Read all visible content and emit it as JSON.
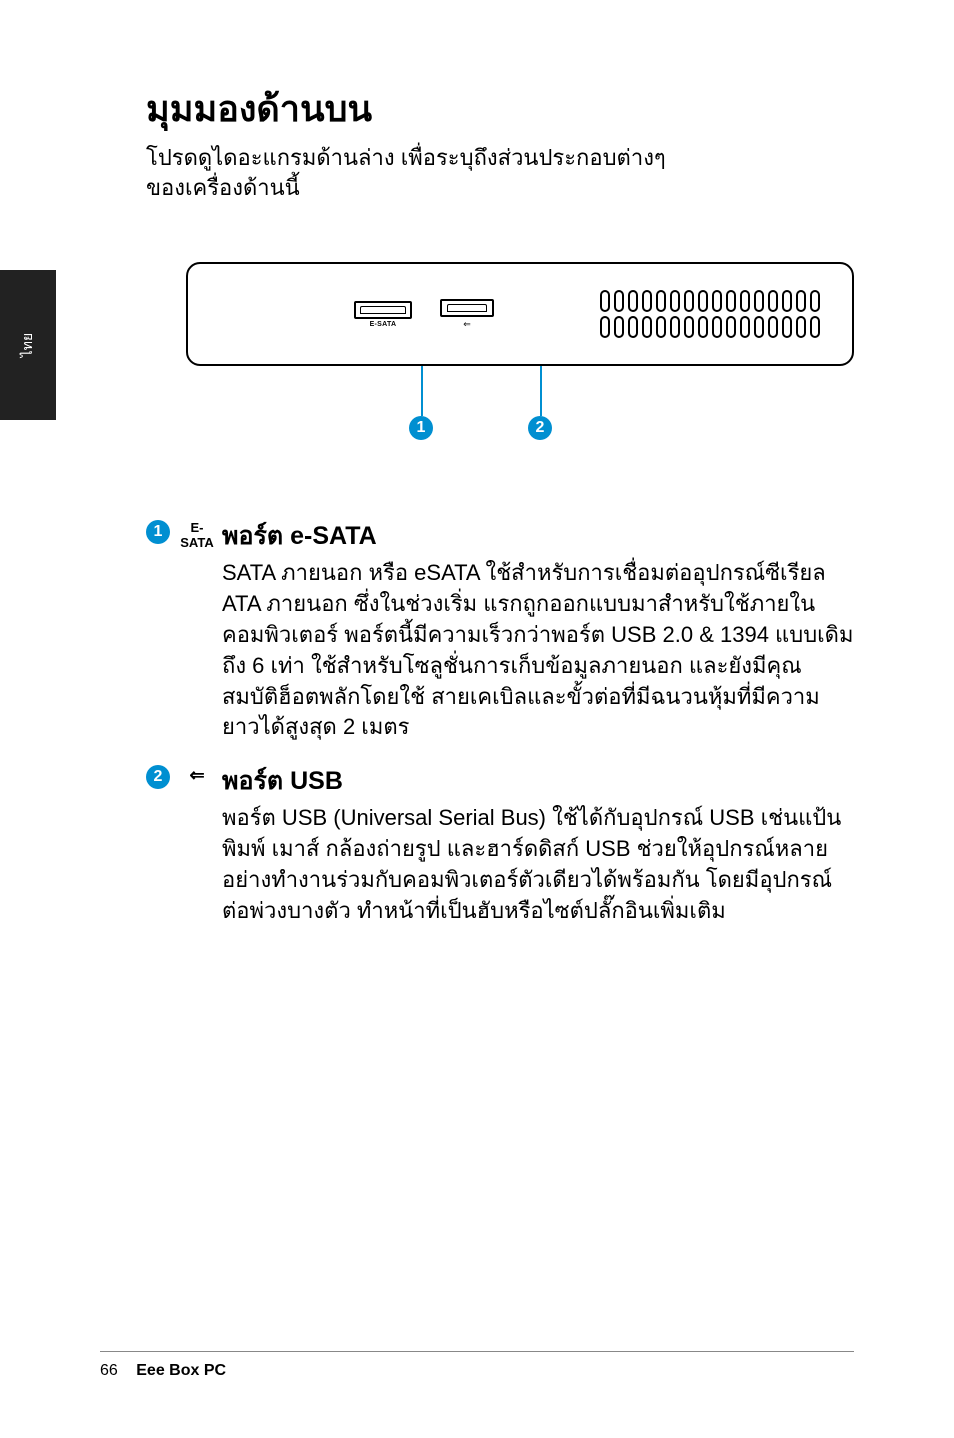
{
  "side_tab": "ไทย",
  "heading": "มุมมองด้านบน",
  "intro_line1": "โปรดดูไดอะแกรมด้านล่าง เพื่อระบุถึงส่วนประกอบต่างๆ",
  "intro_line2": "ของเครื่องด้านนี้",
  "diagram": {
    "esata_label": "E-SATA",
    "usb_icon": "⇐",
    "callouts": [
      "1",
      "2"
    ]
  },
  "items": [
    {
      "num": "1",
      "icon": "E-SATA",
      "title": "พอร์ต e-SATA",
      "body": "SATA ภายนอก หรือ eSATA ใช้สำหรับการเชื่อมต่ออุปกรณ์ซีเรียล ATA ภายนอก ซึ่งในช่วงเริ่ม แรกถูกออกแบบมาสำหรับใช้ภายในคอมพิวเตอร์ พอร์ตนี้มีความเร็วกว่าพอร์ต USB 2.0 & 1394 แบบเดิมถึง 6 เท่า ใช้สำหรับโซลูชั่นการเก็บข้อมูลภายนอก และยังมีคุณสมบัติฮ็อตพลักโดยใช้ สายเคเบิลและขั้วต่อที่มีฉนวนหุ้มที่มีความยาวได้สูงสุด 2 เมตร"
    },
    {
      "num": "2",
      "icon": "⇐",
      "title": "พอร์ต USB",
      "body": "พอร์ต USB (Universal Serial Bus) ใช้ได้กับอุปกรณ์ USB เช่นแป้นพิมพ์ เมาส์ กล้องถ่ายรูป และฮาร์ดดิสก์ USB ช่วยให้อุปกรณ์หลายอย่างทำงานร่วมกับคอมพิวเตอร์ตัวเดียวได้พร้อมกัน โดยมีอุปกรณ์ต่อพ่วงบางตัว ทำหน้าที่เป็นฮับหรือไซต์ปลั๊กอินเพิ่มเติม"
    }
  ],
  "footer": {
    "page": "66",
    "product": "Eee Box PC"
  }
}
